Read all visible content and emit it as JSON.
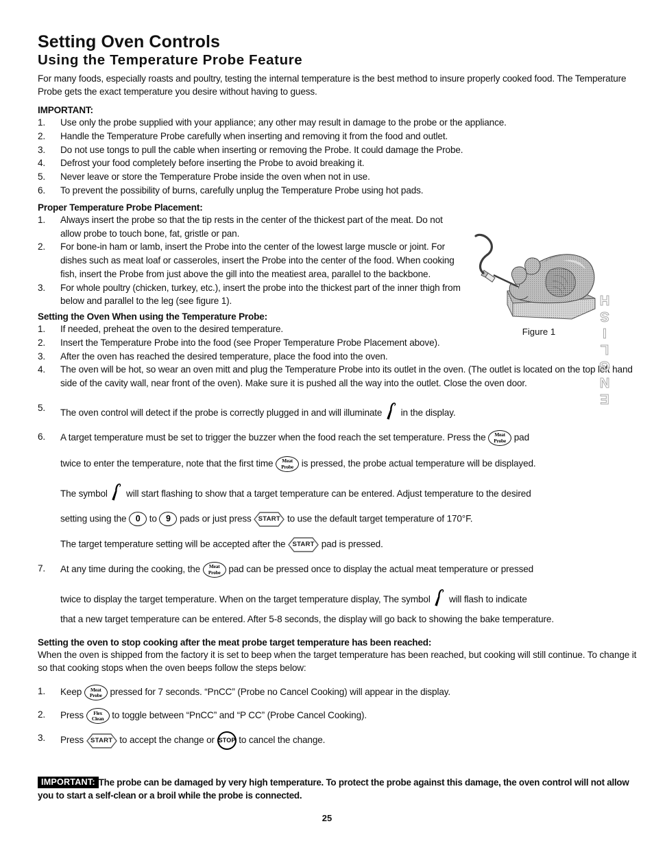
{
  "document": {
    "title": "Setting Oven Controls",
    "subtitle": "Using the Temperature Probe Feature",
    "intro": "For many foods, especially roasts and poultry, testing the internal temperature is the best method to insure properly cooked food. The Temperature Probe gets the exact temperature you desire without having to guess.",
    "page_number": "25",
    "side_tab": "ENGLISH"
  },
  "important_heading": "IMPORTANT:",
  "important_items": [
    "Use only the probe supplied with your appliance; any other may result in damage to the probe or the appliance.",
    "Handle the Temperature Probe carefully when inserting and removing it from the food and outlet.",
    "Do not use tongs to pull the cable when inserting or removing the Probe. It could damage the Probe.",
    "Defrost your food completely before inserting the Probe to avoid breaking it.",
    "Never leave or store the Temperature Probe inside the oven when not in use.",
    "To prevent the possibility of burns, carefully unplug the Temperature Probe using hot pads."
  ],
  "placement": {
    "heading": "Proper Temperature Probe Placement:",
    "items": [
      "Always insert the probe so that the tip rests in the center of the thickest part of the meat.  Do not allow probe to touch bone, fat, gristle or pan.",
      "For bone-in ham or lamb, insert the Probe into the center of the lowest large muscle or joint.  For dishes such as meat loaf or casseroles, insert the Probe into the center of the food. When cooking fish, insert the Probe from just above the gill into the meatiest area, parallel to the backbone.",
      "For whole poultry (chicken, turkey, etc.), insert the probe into the thickest part of the inner thigh from below and parallel to the leg (see figure 1)."
    ]
  },
  "figure": {
    "caption": "Figure 1",
    "alt": "roast-turkey-on-pan-with-temperature-probe-inserted"
  },
  "setting_oven": {
    "heading": "Setting the Oven When using the Temperature Probe:",
    "items": [
      "If needed, preheat the oven to the desired temperature.",
      "Insert the Temperature Probe into the food (see Proper Temperature Probe Placement above).",
      "After the oven has reached the desired temperature, place the food into the oven.",
      "The oven will be hot, so wear an oven mitt and plug the Temperature Probe into its outlet in the oven. (The outlet is located on the top left hand side of the cavity wall, near front of the oven). Make sure it is pushed all the way into the outlet. Close the oven door."
    ],
    "step5": {
      "num": "5.",
      "before": "The oven control will detect if the probe is correctly plugged in and will illuminate",
      "after": "in the display."
    },
    "step6": {
      "num": "6.",
      "line1_before": "A target temperature must be set to trigger the buzzer when the food reach the set temperature. Press the",
      "line1_after": "pad",
      "line2_before": "twice to enter the temperature, note that the first time",
      "line2_after": "is pressed, the probe actual temperature will be displayed.",
      "line3_before": "The symbol",
      "line3_after": "will start flashing to show that a target temperature can be entered. Adjust temperature to the desired",
      "line4_a": "setting using the",
      "line4_b": "to",
      "line4_c": "pads or just press",
      "line4_d": "to use the default target temperature of 170°F.",
      "line5_before": "The target temperature setting will be accepted after the",
      "line5_after": "pad is pressed."
    },
    "step7": {
      "num": "7.",
      "line1_before": "At any time during the cooking, the",
      "line1_after": "pad can be pressed once to display the actual meat temperature or pressed",
      "line2_before": "twice to display the target temperature. When on the target temperature display, The symbol",
      "line2_after": "will flash to indicate",
      "line3": "that a new target temperature can be entered. After 5-8 seconds, the display will go back to showing the bake temperature."
    }
  },
  "stop_cooking": {
    "heading": "Setting the oven to stop cooking after the meat probe target temperature has been reached:",
    "paragraph": "When the oven is shipped from the factory it is set to beep when the target temperature has been reached, but cooking will still continue. To change it so that cooking stops when the oven beeps follow the steps below:",
    "step1": {
      "num": "1.",
      "before": "Keep",
      "after": "pressed for 7 seconds. “PnCC” (Probe no Cancel Cooking) will appear in the display."
    },
    "step2": {
      "num": "2.",
      "before": "Press",
      "after": "to toggle between “PnCC” and “P CC” (Probe Cancel Cooking)."
    },
    "step3": {
      "num": "3.",
      "before": "Press",
      "middle": "to accept the change or",
      "after": "to cancel the change."
    }
  },
  "pads": {
    "meat_probe_line1": "Meat",
    "meat_probe_line2": "Probe",
    "flex_clean_line1": "Flex",
    "flex_clean_line2": "Clean",
    "start": "START",
    "stop": "STOP",
    "zero": "0",
    "nine": "9"
  },
  "footer_important": {
    "tag": "IMPORTANT:",
    "text": "The probe can be damaged by very high temperature. To protect the probe against this damage, the oven control will not allow you to start a self-clean or a broil while the probe is connected."
  },
  "numbers": {
    "n1": "1.",
    "n2": "2.",
    "n3": "3.",
    "n4": "4.",
    "n5": "5.",
    "n6": "6."
  }
}
